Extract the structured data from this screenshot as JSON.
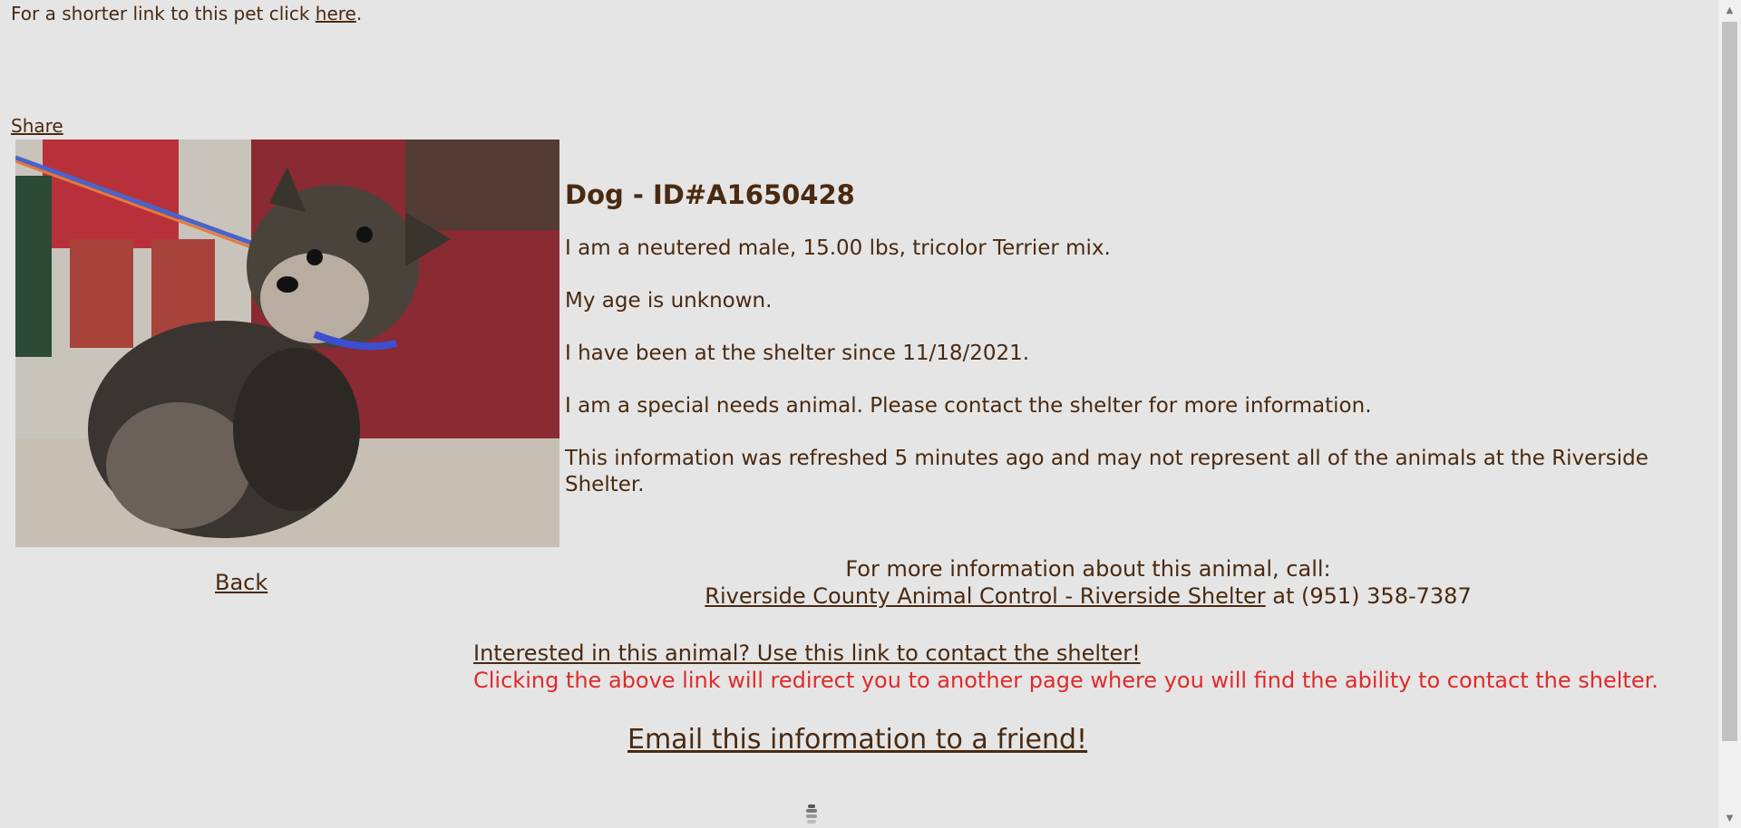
{
  "top": {
    "shorter_link_prefix": "For a shorter link to this pet click ",
    "shorter_link_text": "here",
    "shorter_link_suffix": ".",
    "share_label": "Share"
  },
  "pet": {
    "title": "Dog - ID#A1650428",
    "description": "I am a neutered male, 15.00 lbs, tricolor Terrier mix.",
    "age": "My age is unknown.",
    "since": "I have been at the shelter since 11/18/2021.",
    "special_needs": "I am a special needs animal. Please contact the shelter for more information.",
    "refresh_note": "This information was refreshed 5 minutes ago and may not represent all of the animals at the Riverside Shelter."
  },
  "nav": {
    "back_label": "Back"
  },
  "contact": {
    "intro": "For more information about this animal, call:",
    "shelter_link": "Riverside County Animal Control - Riverside Shelter",
    "phone_text": " at (951) 358-7387",
    "interest_link": "Interested in this animal? Use this link to contact the shelter!",
    "redirect_note": "Clicking the above link will redirect you to another page where you will find the ability to contact the shelter.",
    "email_link": "Email this information to a friend!"
  },
  "colors": {
    "background": "#e5e5e5",
    "text": "#4a2a10",
    "warning": "#e02a2a"
  },
  "icons": {
    "loader": "loader-icon"
  }
}
